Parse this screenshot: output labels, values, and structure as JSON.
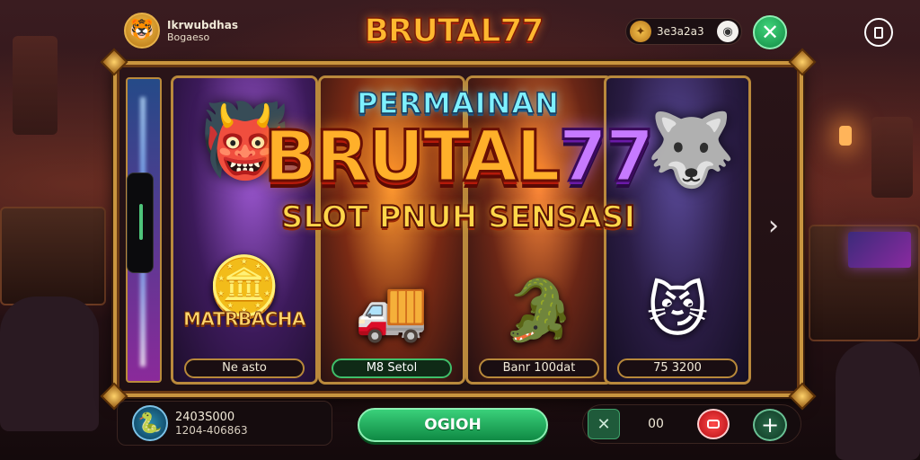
{
  "topbar": {
    "user_name": "Ikrwubdhas",
    "user_sub": "Bogaeso",
    "logo": "BRUTAL77",
    "coins": "3e3a2a3"
  },
  "banner": {
    "kicker": "PERMAINAN",
    "brand_text": "BRUTAL",
    "brand_num": "77",
    "tagline": "SLOT PNUH SENSASI"
  },
  "games": [
    {
      "title": "MATRBACHA",
      "label": "Ne asto",
      "icon": "treasure-chest-icon"
    },
    {
      "title": "",
      "label": "M8 Setol",
      "icon": "truck-monster-icon"
    },
    {
      "title": "",
      "label": "Banr 100dat",
      "icon": "dragon-beast-icon"
    },
    {
      "title": "",
      "label": "75 3200",
      "icon": "golden-cat-icon"
    }
  ],
  "bottom": {
    "line1": "2403S000",
    "line2": "1204-406863",
    "play_label": "OGIOH",
    "count": "00"
  },
  "colors": {
    "accent_gold": "#c9953f",
    "play_green": "#1fb058",
    "alert_red": "#d8141c",
    "brand_orange": "#ffb02a",
    "brand_purple": "#c67aff"
  }
}
